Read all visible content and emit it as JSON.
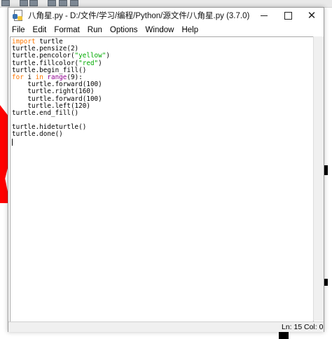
{
  "window": {
    "title": "八角星.py - D:/文件/学习/编程/Python/源文件/八角星.py (3.7.0)",
    "app_icon": "python-idle-icon",
    "controls": [
      "minimize-icon",
      "maximize-icon",
      "close-icon"
    ]
  },
  "menubar": {
    "items": [
      "File",
      "Edit",
      "Format",
      "Run",
      "Options",
      "Window",
      "Help"
    ]
  },
  "editor": {
    "code_lines": [
      "import turtle",
      "turtle.pensize(2)",
      "turtle.pencolor(\"yellow\")",
      "turtle.fillcolor(\"red\")",
      "turtle.begin_fill()",
      "for i in range(9):",
      "    turtle.forward(100)",
      "    turtle.right(160)",
      "    turtle.forward(100)",
      "    turtle.left(120)",
      "turtle.end_fill()",
      "",
      "turtle.hideturtle()",
      "turtle.done()",
      ""
    ]
  },
  "status": {
    "line": "Ln: 15",
    "col": "Col: 0"
  },
  "colors": {
    "keyword": "#ff7700",
    "builtin": "#900090",
    "string": "#00aa00",
    "background_fill": "#ff0000"
  }
}
